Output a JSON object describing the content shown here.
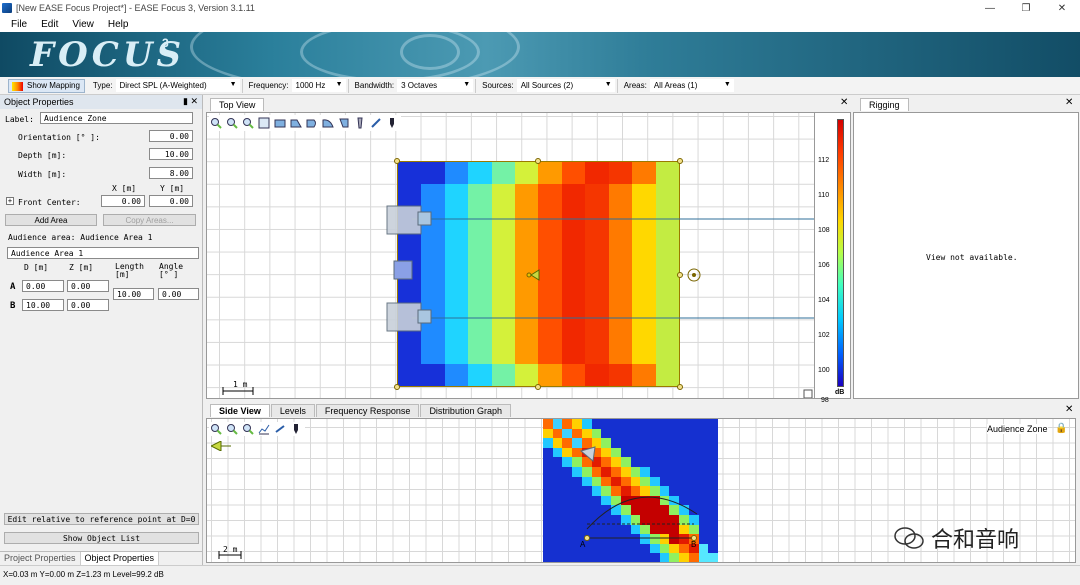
{
  "window": {
    "title": "[New EASE Focus Project*] - EASE Focus 3, Version 3.1.11"
  },
  "menu": [
    "File",
    "Edit",
    "View",
    "Help"
  ],
  "banner": {
    "logo": "FOCUS",
    "sup": "3"
  },
  "toolbar": {
    "show_mapping": "Show Mapping",
    "type_label": "Type:",
    "type_value": "Direct SPL (A-Weighted)",
    "freq_label": "Frequency:",
    "freq_value": "1000 Hz",
    "bw_label": "Bandwidth:",
    "bw_value": "3 Octaves",
    "src_label": "Sources:",
    "src_value": "All Sources (2)",
    "areas_label": "Areas:",
    "areas_value": "All Areas (1)"
  },
  "object_properties": {
    "header": "Object Properties",
    "label_caption": "Label:",
    "label_value": "Audience Zone",
    "orientation_caption": "Orientation [° ]:",
    "orientation_value": "0.00",
    "depth_caption": "Depth [m]:",
    "depth_value": "10.00",
    "width_caption": "Width [m]:",
    "width_value": "8.00",
    "x_caption": "X [m]",
    "y_caption": "Y [m]",
    "front_center_caption": "Front Center:",
    "fc_x": "0.00",
    "fc_y": "0.00",
    "add_area": "Add Area",
    "copy_areas": "Copy Areas...",
    "audience_area_caption": "Audience area: Audience Area 1",
    "audience_area_name": "Audience Area 1",
    "col_d": "D [m]",
    "col_z": "Z [m]",
    "col_length": "Length [m]",
    "col_angle": "Angle [° ]",
    "row_a": "A",
    "row_b": "B",
    "a_d": "0.00",
    "a_z": "0.00",
    "length": "10.00",
    "angle": "0.00",
    "b_d": "10.00",
    "b_z": "0.00",
    "edit_relative": "Edit relative to reference point at D=0",
    "show_object_list": "Show Object List",
    "tab_project": "Project Properties",
    "tab_object": "Object Properties"
  },
  "top_view": {
    "tab": "Top View",
    "scale": "1 m"
  },
  "colorbar": {
    "ticks": [
      "112",
      "110",
      "108",
      "106",
      "104",
      "102",
      "100",
      "98"
    ],
    "unit": "dB"
  },
  "rigging": {
    "tab": "Rigging",
    "message": "View not available."
  },
  "bottom_tabs": [
    "Side View",
    "Levels",
    "Frequency Response",
    "Distribution Graph"
  ],
  "side_view": {
    "zone_label": "Audience Zone",
    "scale": "2 m",
    "point_a": "A",
    "point_b": "B"
  },
  "status": "X=0.03 m Y=0.00 m Z=1.23 m Level=99.2 dB",
  "watermark": "合和音响"
}
